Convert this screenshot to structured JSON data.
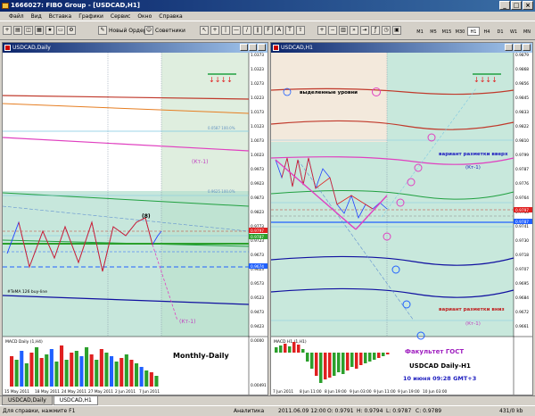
{
  "app": {
    "title": "1666027: FIBO Group - [USDCAD,H1]"
  },
  "menu": [
    "Файл",
    "Вид",
    "Вставка",
    "Графики",
    "Сервис",
    "Окно",
    "Справка"
  ],
  "toolbar": {
    "new_order": "Новый Ордер",
    "advisors": "Советники",
    "timeframes": [
      "M1",
      "M5",
      "M15",
      "M30",
      "H1",
      "H4",
      "D1",
      "W1",
      "MN"
    ],
    "active_timeframe": "H1"
  },
  "left_chart": {
    "title": "USDCAD,Daily",
    "channel_label": "(Кт-1)",
    "channel_label_2": "(Кт-1)",
    "wave_label": "(8)",
    "fibo_label_1": "0.0587  100.0%",
    "fibo_label_2": "0.9625  100.0%",
    "ma_label": "#TeMA 126 buy-line",
    "price_scale": [
      "1.0373",
      "1.0323",
      "1.0273",
      "1.0223",
      "1.0173",
      "1.0123",
      "1.0073",
      "1.0023",
      "0.9973",
      "0.9923",
      "0.9873",
      "0.9823",
      "0.9773",
      "0.9723",
      "0.9673",
      "0.9623",
      "0.9573",
      "0.9523",
      "0.9473",
      "0.9423"
    ],
    "price_tag_red": "0.9797",
    "price_tag_green": "0.9787",
    "price_tag_blue": "0.9674",
    "indicator_label": "MACD Daily (1,H4)",
    "indicator_scale_top": "0.0000",
    "indicator_scale_bottom": "0.00491",
    "caption": "Monthly-Daily",
    "dates": [
      "15 May 2011",
      "18 May 2011",
      "24 May 2011",
      "27 May 2011",
      "2 Jun 2011",
      "7 Jun 2011"
    ]
  },
  "right_chart": {
    "title": "USDCAD,H1",
    "selected_levels": "выделенные уровни",
    "variant_up": "вариант разметки вверх",
    "variant_down": "вариант разметки вниз",
    "channel_label": "(Кт-1)",
    "channel_label_2": "(Кт-1)",
    "price_scale": [
      "0.9879",
      "0.9868",
      "0.9856",
      "0.9845",
      "0.9833",
      "0.9822",
      "0.9810",
      "0.9799",
      "0.9787",
      "0.9776",
      "0.9764",
      "0.9753",
      "0.9741",
      "0.9730",
      "0.9718",
      "0.9707",
      "0.9695",
      "0.9684",
      "0.9672",
      "0.9661"
    ],
    "price_tag_red": "0.9797",
    "price_tag_blue": "0.9787",
    "indicator_label": "MACD H1 (1,H1)",
    "faculty": "Факультет ГОСТ",
    "pair_caption": "USDCAD Daily-H1",
    "date_caption": "10 июня 09:28 GMT+3",
    "dates": [
      "7 Jun 2011",
      "8 Jun 11:00",
      "8 Jun 19:00",
      "9 Jun 03:00",
      "9 Jun 11:00",
      "9 Jun 19:00",
      "10 Jun 03:00"
    ]
  },
  "tabs": [
    "USDCAD,Daily",
    "USDCAD,H1"
  ],
  "active_tab": "USDCAD,H1",
  "status": {
    "help": "Для справки, нажмите F1",
    "profile": "Аналитика",
    "datetime": "2011.06.09 12:00",
    "open": "O: 0.9791",
    "high": "H: 0.9794",
    "low": "L: 0.9787",
    "close": "C: 0.9789",
    "traffic": "431/0 kb"
  }
}
